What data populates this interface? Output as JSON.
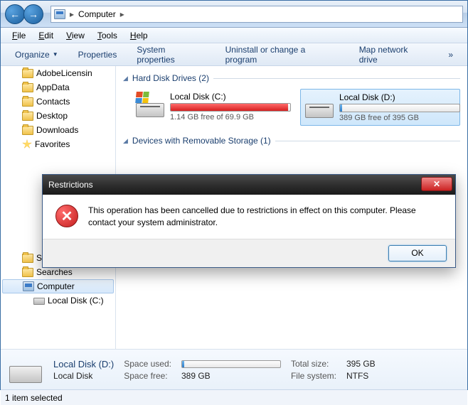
{
  "breadcrumb": {
    "location": "Computer"
  },
  "menu": {
    "file": "File",
    "edit": "Edit",
    "view": "View",
    "tools": "Tools",
    "help": "Help"
  },
  "toolbar": {
    "organize": "Organize",
    "properties": "Properties",
    "system_properties": "System properties",
    "uninstall": "Uninstall or change a program",
    "map_drive": "Map network drive",
    "more": "»"
  },
  "sidebar": {
    "items": [
      {
        "label": "AdobeLicensin",
        "icon": "folder"
      },
      {
        "label": "AppData",
        "icon": "folder"
      },
      {
        "label": "Contacts",
        "icon": "folder"
      },
      {
        "label": "Desktop",
        "icon": "folder"
      },
      {
        "label": "Downloads",
        "icon": "folder"
      },
      {
        "label": "Favorites",
        "icon": "favorites"
      },
      {
        "label": "Saved Games",
        "icon": "folder"
      },
      {
        "label": "Searches",
        "icon": "folder"
      },
      {
        "label": "Computer",
        "icon": "computer",
        "selected": true
      },
      {
        "label": "Local Disk (C:)",
        "icon": "drive"
      }
    ]
  },
  "sections": {
    "hdd": "Hard Disk Drives (2)",
    "removable": "Devices with Removable Storage (1)"
  },
  "drives": [
    {
      "name": "Local Disk (C:)",
      "free_text": "1.14 GB free of 69.9 GB",
      "fill_pct": 98,
      "color": "red",
      "selected": false,
      "winlogo": true
    },
    {
      "name": "Local Disk (D:)",
      "free_text": "389 GB free of 395 GB",
      "fill_pct": 2,
      "color": "blue",
      "selected": true,
      "winlogo": false
    }
  ],
  "details": {
    "title": "Local Disk (D:)",
    "subtitle": "Local Disk",
    "space_used_lbl": "Space used:",
    "space_free_lbl": "Space free:",
    "space_free_val": "389 GB",
    "total_lbl": "Total size:",
    "total_val": "395 GB",
    "fs_lbl": "File system:",
    "fs_val": "NTFS"
  },
  "status": "1 item selected",
  "dialog": {
    "title": "Restrictions",
    "message": "This operation has been cancelled due to restrictions in effect on this computer. Please contact your system administrator.",
    "ok": "OK"
  }
}
